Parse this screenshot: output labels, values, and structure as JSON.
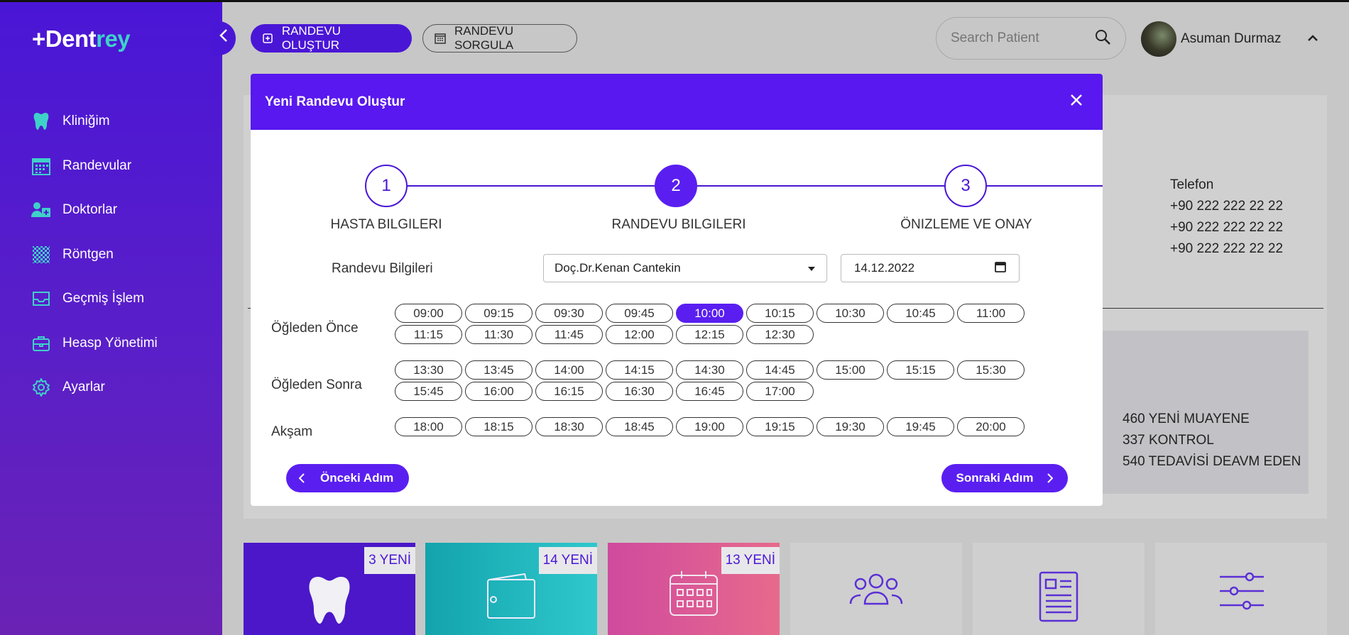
{
  "app": {
    "logo_plus": "+Dent",
    "logo_accent": "rey"
  },
  "sidebar": {
    "items": [
      {
        "label": "Kliniğim",
        "icon": "tooth-icon"
      },
      {
        "label": "Randevular",
        "icon": "calendar-icon"
      },
      {
        "label": "Doktorlar",
        "icon": "doctors-icon"
      },
      {
        "label": "Röntgen",
        "icon": "xray-icon"
      },
      {
        "label": "Geçmiş İşlem",
        "icon": "inbox-icon"
      },
      {
        "label": "Heasp Yönetimi",
        "icon": "briefcase-icon"
      },
      {
        "label": "Ayarlar",
        "icon": "gear-icon"
      }
    ]
  },
  "topbar": {
    "create_label": "RANDEVU OLUŞTUR",
    "query_label": "RANDEVU SORGULA",
    "search_placeholder": "Search Patient",
    "user_name": "Asuman Durmaz"
  },
  "background": {
    "phone_label": "Telefon",
    "phones": [
      "+90 222 222 22 22",
      "+90 222 222 22 22",
      "+90 222 222 22 22"
    ],
    "stats": [
      "460 YENİ MUAYENE",
      "337 KONTROL",
      "540 TEDAVİSİ DEAVM EDEN"
    ],
    "cards": [
      {
        "badge": "3 YENİ",
        "icon": "tooth-icon"
      },
      {
        "badge": "14 YENİ",
        "icon": "wallet-icon"
      },
      {
        "badge": "13 YENİ",
        "icon": "calendar-icon"
      },
      {
        "badge": "",
        "icon": "users-icon"
      },
      {
        "badge": "",
        "icon": "document-icon"
      },
      {
        "badge": "",
        "icon": "sliders-icon"
      }
    ]
  },
  "modal": {
    "title": "Yeni Randevu Oluştur",
    "steps": [
      {
        "number": "1",
        "label": "HASTA BILGILERI",
        "active": false
      },
      {
        "number": "2",
        "label": "RANDEVU BILGILERI",
        "active": true
      },
      {
        "number": "3",
        "label": "ÖNIZLEME VE ONAY",
        "active": false
      }
    ],
    "form_label": "Randevu Bilgileri",
    "doctor_selected": "Doç.Dr.Kenan Cantekin",
    "date_value": "14.12.2022",
    "slot_groups": [
      {
        "label": "Öğleden Önce",
        "slots": [
          "09:00",
          "09:15",
          "09:30",
          "09:45",
          "10:00",
          "10:15",
          "10:30",
          "10:45",
          "11:00",
          "11:15",
          "11:30",
          "11:45",
          "12:00",
          "12:15",
          "12:30"
        ]
      },
      {
        "label": "Öğleden Sonra",
        "slots": [
          "13:30",
          "13:45",
          "14:00",
          "14:15",
          "14:30",
          "14:45",
          "15:00",
          "15:15",
          "15:30",
          "15:45",
          "16:00",
          "16:15",
          "16:30",
          "16:45",
          "17:00"
        ]
      },
      {
        "label": "Akşam",
        "slots": [
          "18:00",
          "18:15",
          "18:30",
          "18:45",
          "19:00",
          "19:15",
          "19:30",
          "19:45",
          "20:00"
        ]
      }
    ],
    "selected_slot": "10:00",
    "prev_label": "Önceki Adım",
    "next_label": "Sonraki Adım"
  },
  "colors": {
    "primary": "#5a1ff0",
    "sidebar": "#4a16d6",
    "teal": "#3fd1c9",
    "pink": "#d04a9e"
  }
}
